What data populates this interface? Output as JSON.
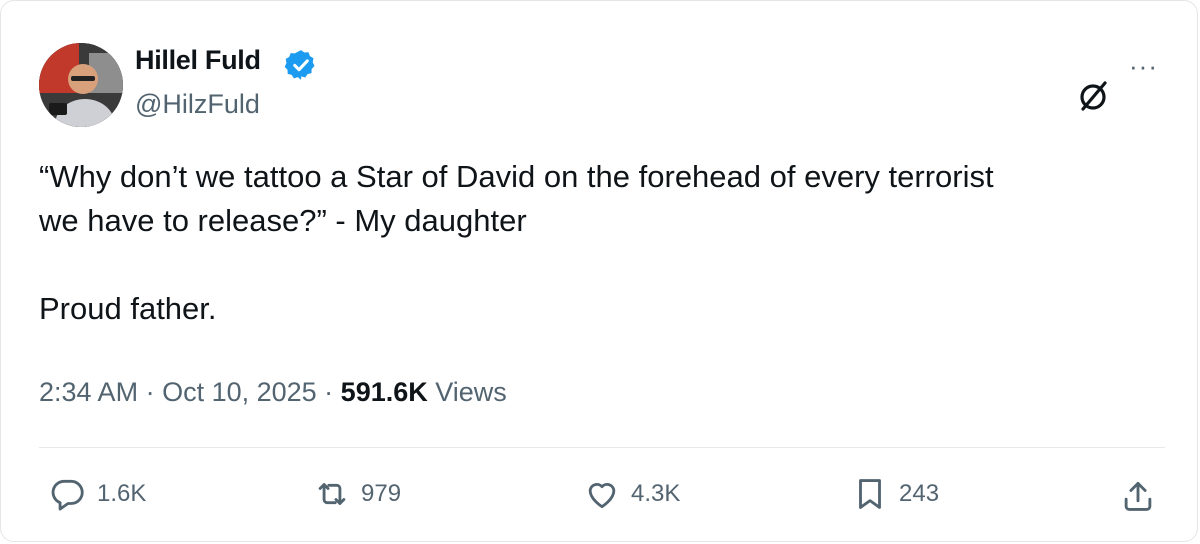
{
  "author": {
    "name": "Hillel Fuld",
    "handle": "@HilzFuld"
  },
  "tweet": {
    "text": "“Why don’t we tattoo a Star of David on the forehead of every terrorist\nwe have to release?” - My daughter\n\nProud father."
  },
  "meta": {
    "time": "2:34 AM",
    "sep1": " · ",
    "date": "Oct 10, 2025",
    "sep2": " · ",
    "views_count": "591.6K",
    "views_label": " Views"
  },
  "actions": {
    "replies": "1.6K",
    "reposts": "979",
    "likes": "4.3K",
    "bookmarks": "243"
  },
  "icons": {
    "reply": "reply-icon",
    "repost": "repost-icon",
    "like": "heart-icon",
    "bookmark": "bookmark-icon",
    "share": "share-icon",
    "grok": "grok-icon",
    "more": "more-icon",
    "verified": "verified-badge-icon"
  },
  "colors": {
    "verified": "#1d9bf0",
    "secondary_text": "#536471",
    "primary_text": "#0f1419"
  }
}
